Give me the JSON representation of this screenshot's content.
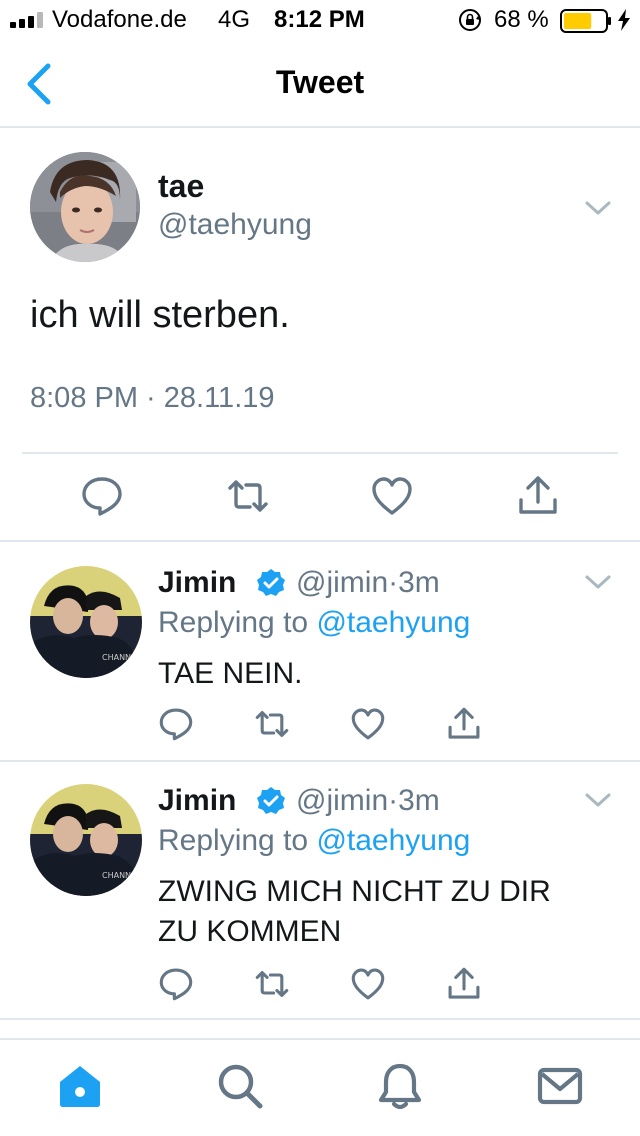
{
  "status_bar": {
    "carrier": "Vodafone.de",
    "network": "4G",
    "time": "8:12 PM",
    "battery_percent": "68 %",
    "battery_level": 0.68,
    "battery_color": "#ffcc00",
    "icons": [
      "signal-bars-icon",
      "rotation-lock-icon",
      "battery-icon",
      "charging-bolt-icon"
    ]
  },
  "nav": {
    "title": "Tweet",
    "back_icon": "chevron-left-icon",
    "accent": "#1da1f2"
  },
  "main_tweet": {
    "name": "tae",
    "handle": "@taehyung",
    "text": "ich will sterben.",
    "timestamp": "8:08 PM · 28.11.19",
    "actions": [
      "reply-icon",
      "retweet-icon",
      "like-icon",
      "share-icon"
    ]
  },
  "replies": [
    {
      "name": "Jimin",
      "handle": "@jimin",
      "separator": "·",
      "age": "3m",
      "replying_prefix": "Replying to",
      "replying_to": "@taehyung",
      "text": "TAE NEIN."
    },
    {
      "name": "Jimin",
      "handle": "@jimin",
      "separator": "·",
      "age": "3m",
      "replying_prefix": "Replying to",
      "replying_to": "@taehyung",
      "text": "ZWING MICH NICHT ZU DIR ZU KOMMEN"
    }
  ],
  "tab_bar": {
    "tabs": [
      "home-icon",
      "search-icon",
      "notifications-icon",
      "messages-icon"
    ],
    "active": "home-icon"
  },
  "colors": {
    "text": "#14171a",
    "secondary": "#657786",
    "link": "#1da1f2",
    "divider": "#e1e8ed"
  }
}
